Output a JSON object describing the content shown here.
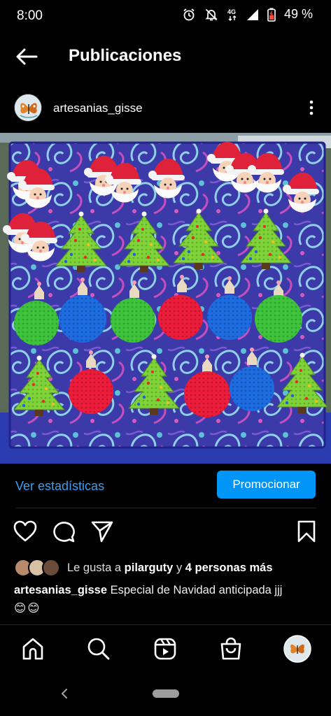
{
  "status_bar": {
    "time": "8:00",
    "network": "4G",
    "battery": "49 %",
    "icons": [
      "alarm-icon",
      "mute-icon",
      "signal-icon",
      "battery-icon"
    ]
  },
  "header": {
    "title": "Publicaciones",
    "back_icon": "arrow-left-icon"
  },
  "post": {
    "username": "artesanias_gisse",
    "menu_icon": "more-vertical-icon",
    "image_subject": "crochet christmas ornaments"
  },
  "stats": {
    "link_label": "Ver estadísticas",
    "promote_label": "Promocionar"
  },
  "actions": {
    "icons": [
      "heart-icon",
      "comment-icon",
      "share-icon",
      "bookmark-icon"
    ]
  },
  "likes": {
    "prefix": "Le gusta a",
    "user": "pilarguty",
    "connector": "y",
    "others": "4 personas más"
  },
  "caption": {
    "username": "artesanias_gisse",
    "text": "Especial de Navidad anticipada jjj",
    "emojis": [
      "😊",
      "😊"
    ]
  },
  "bottom_nav": {
    "items": [
      "home-icon",
      "search-icon",
      "reels-icon",
      "shop-icon",
      "profile-avatar"
    ]
  },
  "colors": {
    "accent_blue": "#0095f6",
    "link_blue": "#3a9ff0",
    "background": "#000000"
  }
}
